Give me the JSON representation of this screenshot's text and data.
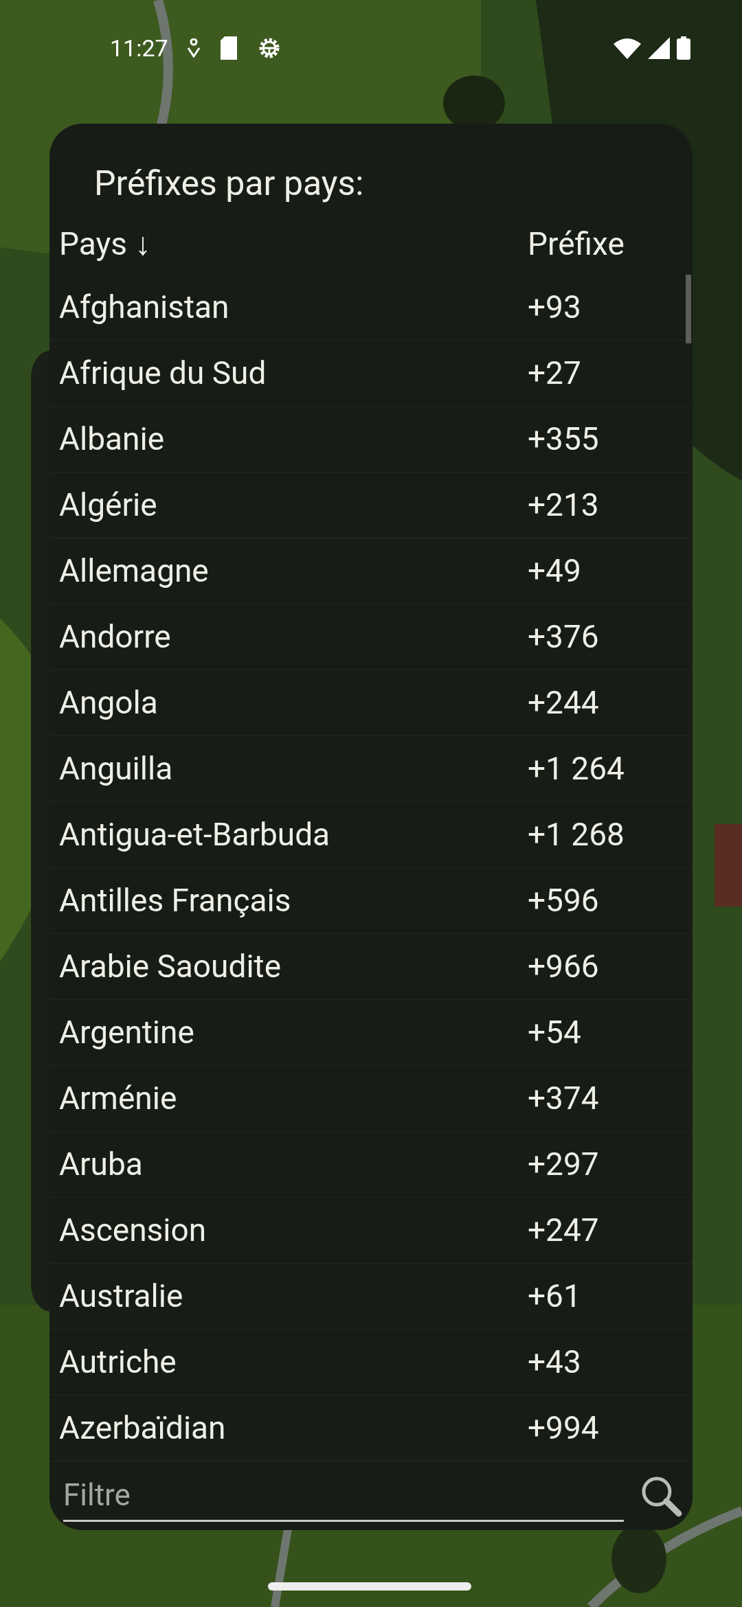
{
  "status_bar": {
    "time": "11:27"
  },
  "dialog": {
    "title": "Préfixes par pays:",
    "columns": [
      "Pays ↓",
      "Préfixe"
    ],
    "rows": [
      {
        "country": "Afghanistan",
        "prefix": "+93"
      },
      {
        "country": "Afrique du Sud",
        "prefix": "+27"
      },
      {
        "country": "Albanie",
        "prefix": "+355"
      },
      {
        "country": "Algérie",
        "prefix": "+213"
      },
      {
        "country": "Allemagne",
        "prefix": "+49"
      },
      {
        "country": "Andorre",
        "prefix": "+376"
      },
      {
        "country": "Angola",
        "prefix": "+244"
      },
      {
        "country": "Anguilla",
        "prefix": "+1 264"
      },
      {
        "country": "Antigua-et-Barbuda",
        "prefix": "+1 268"
      },
      {
        "country": "Antilles Français",
        "prefix": "+596"
      },
      {
        "country": "Arabie Saoudite",
        "prefix": "+966"
      },
      {
        "country": "Argentine",
        "prefix": "+54"
      },
      {
        "country": "Arménie",
        "prefix": "+374"
      },
      {
        "country": "Aruba",
        "prefix": "+297"
      },
      {
        "country": "Ascension",
        "prefix": "+247"
      },
      {
        "country": "Australie",
        "prefix": "+61"
      },
      {
        "country": "Autriche",
        "prefix": "+43"
      },
      {
        "country": "Azerbaïdian",
        "prefix": "+994"
      }
    ],
    "filter": {
      "placeholder": "Filtre"
    }
  }
}
